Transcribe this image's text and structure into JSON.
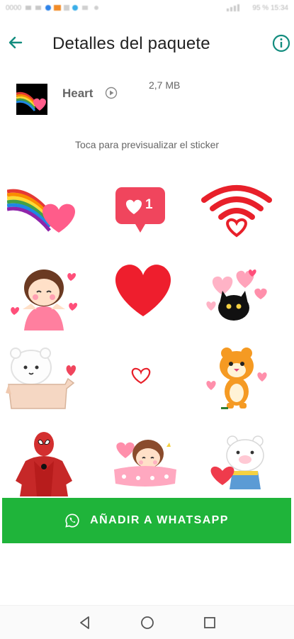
{
  "status_bar": {
    "left_text": "0000",
    "right_text": "95 %  15:34"
  },
  "app_bar": {
    "title": "Detalles del paquete",
    "back_icon": "arrow-left-icon",
    "info_icon": "info-icon",
    "accent_color": "#128C7E"
  },
  "pack": {
    "name": "Heart",
    "size": "2,7 MB",
    "play_icon": "play-circle-icon"
  },
  "hint": "Toca para previsualizar el sticker",
  "stickers": [
    {
      "id": "rainbow-heart"
    },
    {
      "id": "like-notification"
    },
    {
      "id": "wifi-heart"
    },
    {
      "id": "girl-hearts"
    },
    {
      "id": "red-heart"
    },
    {
      "id": "black-cat-hearts"
    },
    {
      "id": "bear-box"
    },
    {
      "id": "small-heart-outline"
    },
    {
      "id": "tiger-hearts"
    },
    {
      "id": "spiderman"
    },
    {
      "id": "girl-blanket"
    },
    {
      "id": "pig-heart"
    }
  ],
  "like_count": "1",
  "add_button": {
    "label": "AÑADIR A WHATSAPP",
    "icon": "whatsapp-icon",
    "color": "#1FB43A"
  },
  "nav_bar": {
    "back_icon": "nav-back-icon",
    "home_icon": "nav-home-icon",
    "recents_icon": "nav-recents-icon"
  }
}
